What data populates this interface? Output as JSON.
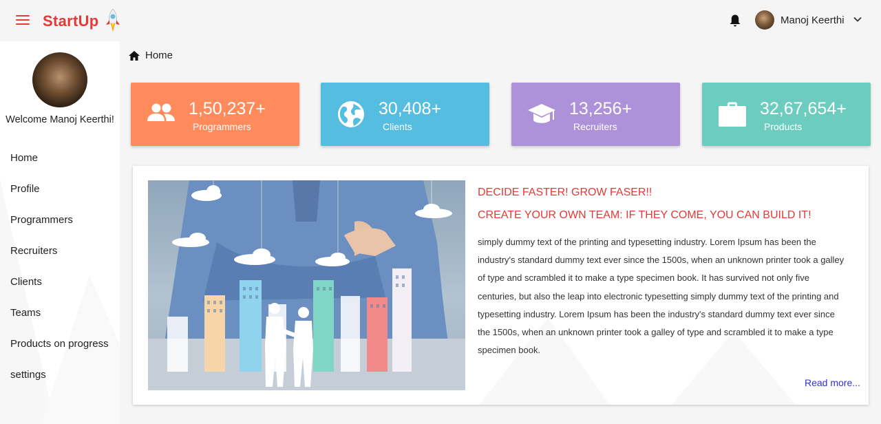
{
  "header": {
    "brand": "StartUp",
    "user_name": "Manoj Keerthi"
  },
  "sidebar": {
    "welcome": "Welcome Manoj Keerthi!",
    "items": [
      {
        "label": "Home"
      },
      {
        "label": "Profile"
      },
      {
        "label": "Programmers"
      },
      {
        "label": "Recruiters"
      },
      {
        "label": "Clients"
      },
      {
        "label": "Teams"
      },
      {
        "label": "Products on progress"
      },
      {
        "label": "settings"
      }
    ]
  },
  "breadcrumb": {
    "label": "Home"
  },
  "stats": [
    {
      "value": "1,50,237+",
      "label": "Programmers",
      "color": "#ff8a5c",
      "icon": "users-icon"
    },
    {
      "value": "30,408+",
      "label": "Clients",
      "color": "#55bde0",
      "icon": "globe-icon"
    },
    {
      "value": "13,256+",
      "label": "Recruiters",
      "color": "#ad92d9",
      "icon": "graduation-cap-icon"
    },
    {
      "value": "32,67,654+",
      "label": "Products",
      "color": "#6ccdbe",
      "icon": "briefcase-icon"
    }
  ],
  "article": {
    "heading1": "DECIDE FASTER! GROW FASER!!",
    "heading2": "CREATE YOUR OWN TEAM: IF THEY COME, YOU CAN BUILD IT!",
    "body": "simply dummy text of the printing and typesetting industry. Lorem Ipsum has been the industry's standard dummy text ever since the 1500s, when an unknown printer took a galley of type and scrambled it to make a type specimen book. It has survived not only five centuries, but also the leap into electronic typesetting simply dummy text of the printing and typesetting industry. Lorem Ipsum has been the industry's standard dummy text ever since the 1500s, when an unknown printer took a galley of type and scrambled it to make a type specimen book.",
    "read_more": "Read more..."
  },
  "colors": {
    "accent": "#e53935",
    "link": "#3030d0"
  }
}
